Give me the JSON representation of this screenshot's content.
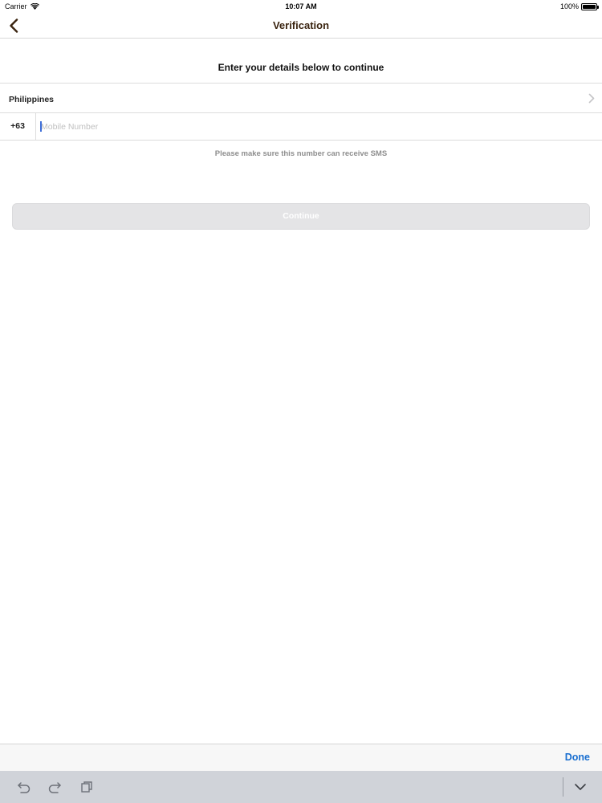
{
  "status_bar": {
    "carrier": "Carrier",
    "time": "10:07 AM",
    "battery": "100%"
  },
  "nav": {
    "title": "Verification",
    "back_icon": "chevron-left-icon"
  },
  "form": {
    "subtitle": "Enter your details below to continue",
    "country": "Philippines",
    "country_code": "+63",
    "mobile_placeholder": "Mobile Number",
    "mobile_value": "",
    "hint": "Please make sure this number can receive SMS",
    "continue_label": "Continue"
  },
  "keyboard": {
    "done_label": "Done",
    "icons": [
      "undo-icon",
      "redo-icon",
      "paste-icon",
      "dismiss-keyboard-icon"
    ]
  },
  "colors": {
    "title": "#3a2410",
    "accent_blue": "#1a6fd0",
    "disabled_button": "#e4e4e6"
  }
}
